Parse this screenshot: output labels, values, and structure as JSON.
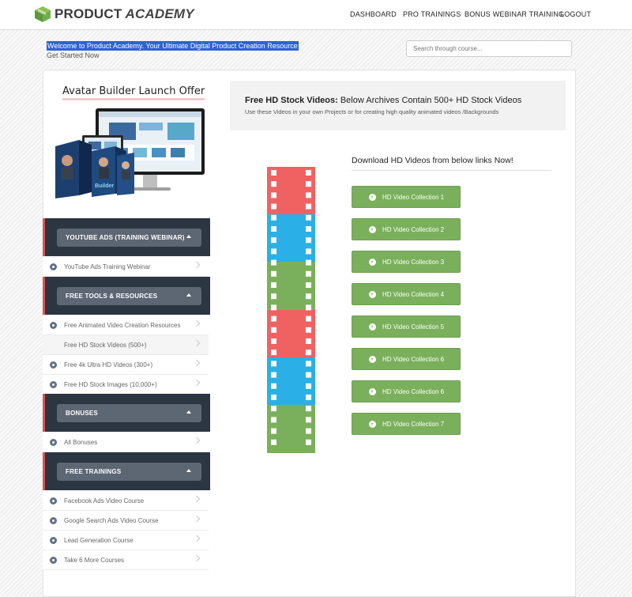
{
  "header": {
    "logo_text": "PRODUCT",
    "logo_text_accent": "ACADEMY",
    "nav": [
      "DASHBOARD",
      "PRO TRAININGS",
      "BONUS WEBINAR TRAINING",
      "LOGOUT"
    ]
  },
  "banner": {
    "welcome": "Welcome to Product Academy. Your Ultimate Digital Product Creation Resource",
    "get_started": "Get Started Now"
  },
  "search": {
    "placeholder": "Search through course..."
  },
  "sidebar": {
    "promo_title": "Avatar Builder Launch Offer",
    "sections": [
      {
        "title": "YOUTUBE ADS (TRAINING WEBINAR)",
        "items": [
          "YouTube Ads Training Webinar"
        ]
      },
      {
        "title": "FREE TOOLS & RESOURCES",
        "items": [
          "Free Animated Video Creation Resources",
          "Free HD Stock Videos (500+)",
          "Free 4k Ultra HD Videos (300+)",
          "Free HD Stock Images (10,000+)"
        ]
      },
      {
        "title": "BONUSES",
        "items": [
          "All Bonuses"
        ]
      },
      {
        "title": "FREE TRAININGS",
        "items": [
          "Facebook Ads Video Course",
          "Google Search Ads Video Course",
          "Lead Generation Course",
          "Take 6 More Courses"
        ]
      }
    ]
  },
  "main": {
    "hero_title_bold": "Free HD Stock Videos:",
    "hero_title_rest": " Below Archives Contain 500+ HD Stock Videos",
    "hero_sub": "Use these Videos in your own Projects or for creating high quality animated videos /Backgrounds",
    "download_heading": "Download HD Videos from below links Now!",
    "buttons": [
      "HD Video Collection 1",
      "HD Video Collection 2",
      "HD Video Collection 3",
      "HD Video Collection 4",
      "HD Video Collection 5",
      "HD Video Collection 6",
      "HD Video Collection 6",
      "HD Video Collection 7"
    ]
  },
  "colors": {
    "accent_green": "#7ab05b",
    "sidebar_dark": "#2c3542",
    "sidebar_red": "#d9534f",
    "film_red": "#f06262",
    "film_blue": "#2ab0e6",
    "film_green": "#7ab05b"
  }
}
